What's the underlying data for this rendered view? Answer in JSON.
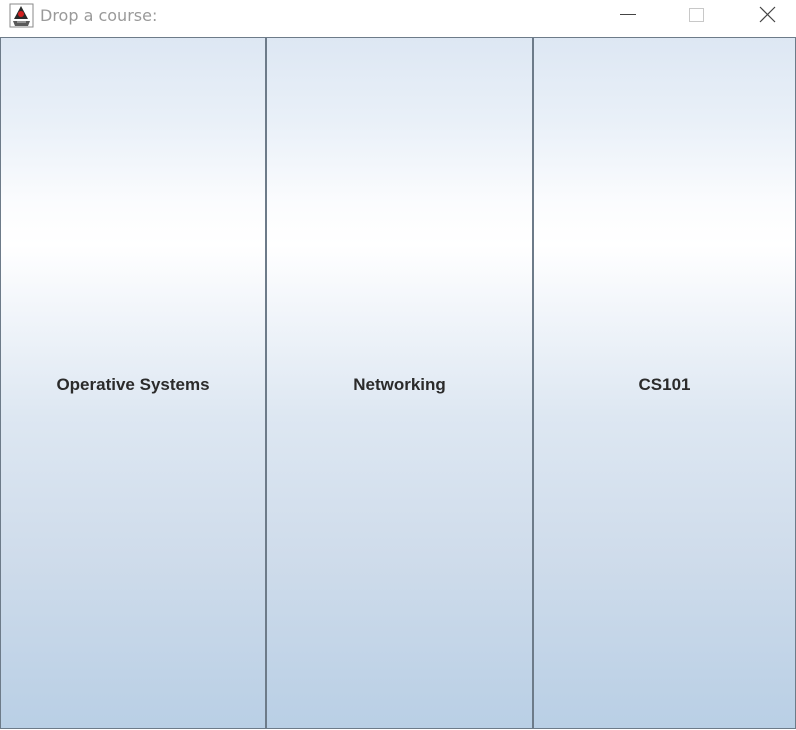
{
  "window": {
    "title": "Drop a course:",
    "app_icon": "java-duke-icon",
    "controls": {
      "minimize_icon": "minimize-icon",
      "maximize_icon": "maximize-icon",
      "close_icon": "close-icon"
    }
  },
  "courses": [
    {
      "label": "Operative Systems"
    },
    {
      "label": "Networking"
    },
    {
      "label": "CS101"
    }
  ],
  "colors": {
    "button_border": "#6d7b89",
    "button_gradient_top": "#dde7f3",
    "button_gradient_bottom": "#b9cfe5",
    "label_text": "#2b2b2b",
    "title_text": "#9a9a9a"
  }
}
